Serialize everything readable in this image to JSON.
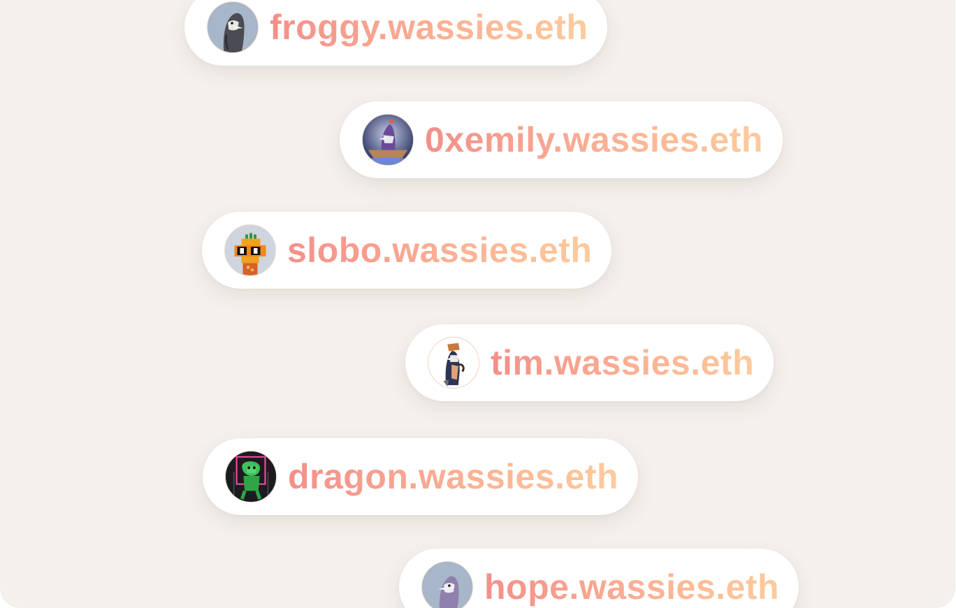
{
  "accent_gradient": [
    "#f48f8a",
    "#fbb495",
    "#fdcb9c"
  ],
  "background": "#f4f0ec",
  "names": [
    {
      "label": "froggy.wassies.eth",
      "avatar": "penguin-grey-avatar"
    },
    {
      "label": "0xemily.wassies.eth",
      "avatar": "penguin-boat-avatar"
    },
    {
      "label": "slobo.wassies.eth",
      "avatar": "pixel-pineapple-avatar"
    },
    {
      "label": "tim.wassies.eth",
      "avatar": "penguin-hat-avatar"
    },
    {
      "label": "dragon.wassies.eth",
      "avatar": "green-dragon-avatar"
    },
    {
      "label": "hope.wassies.eth",
      "avatar": "penguin-lavender-avatar"
    }
  ]
}
